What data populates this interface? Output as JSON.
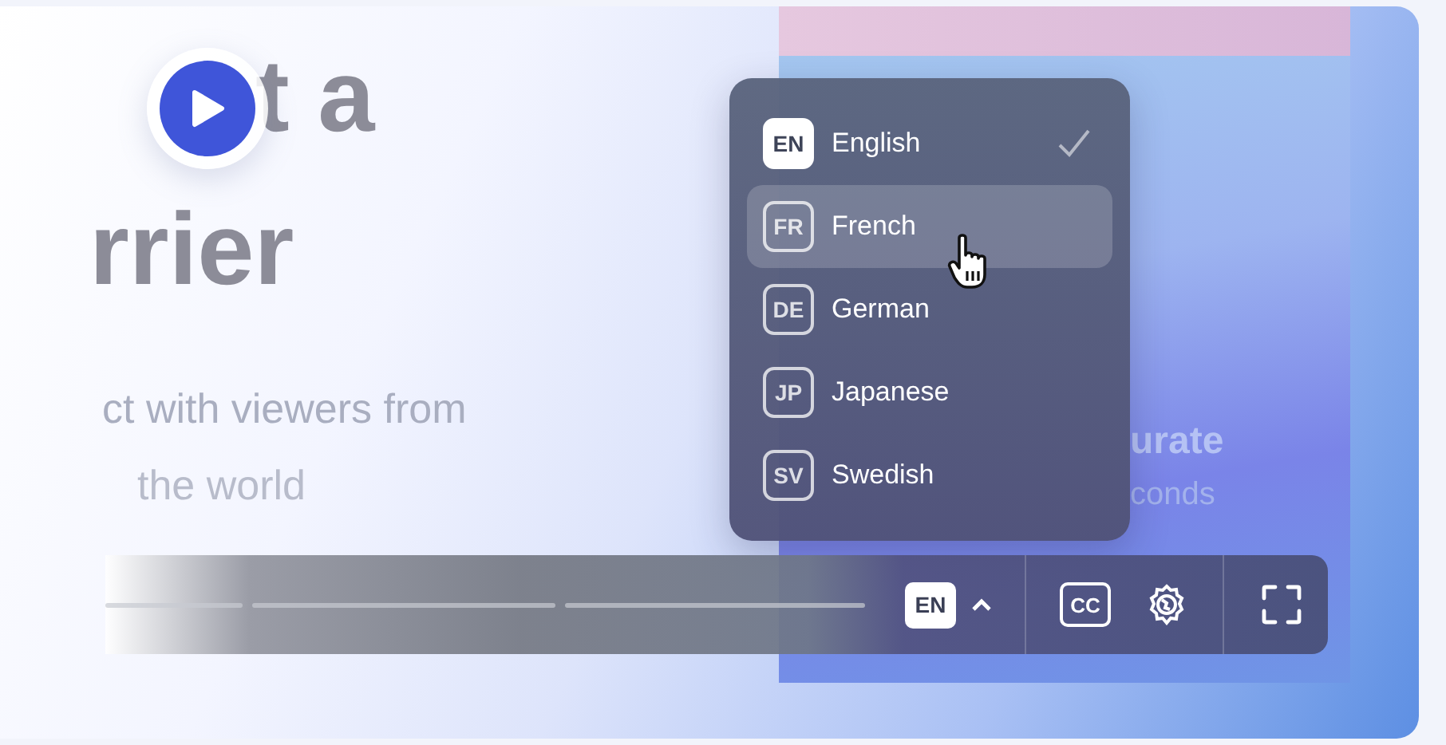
{
  "slide": {
    "headline": [
      "t a",
      "rrier"
    ],
    "subtitle": [
      "ct with viewers from",
      "the world"
    ],
    "panel_texts": [
      "urate",
      "conds"
    ]
  },
  "language_menu": {
    "items": [
      {
        "code": "EN",
        "label": "English",
        "checked": true,
        "hovered": false
      },
      {
        "code": "FR",
        "label": "French",
        "checked": false,
        "hovered": true
      },
      {
        "code": "DE",
        "label": "German",
        "checked": false,
        "hovered": false
      },
      {
        "code": "JP",
        "label": "Japanese",
        "checked": false,
        "hovered": false
      },
      {
        "code": "SV",
        "label": "Swedish",
        "checked": false,
        "hovered": false
      }
    ]
  },
  "control_bar": {
    "language_code": "EN",
    "captions_label": "CC"
  }
}
